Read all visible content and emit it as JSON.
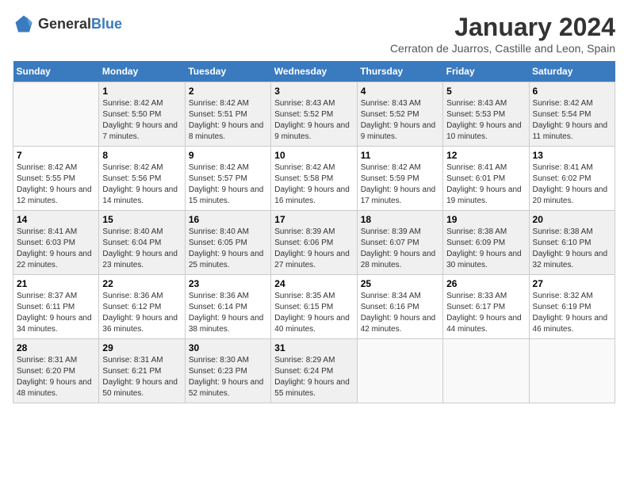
{
  "logo": {
    "text_general": "General",
    "text_blue": "Blue"
  },
  "title": "January 2024",
  "subtitle": "Cerraton de Juarros, Castille and Leon, Spain",
  "weekdays": [
    "Sunday",
    "Monday",
    "Tuesday",
    "Wednesday",
    "Thursday",
    "Friday",
    "Saturday"
  ],
  "weeks": [
    [
      {
        "day": "",
        "sunrise": "",
        "sunset": "",
        "daylight": "",
        "empty": true
      },
      {
        "day": "1",
        "sunrise": "Sunrise: 8:42 AM",
        "sunset": "Sunset: 5:50 PM",
        "daylight": "Daylight: 9 hours and 7 minutes.",
        "empty": false
      },
      {
        "day": "2",
        "sunrise": "Sunrise: 8:42 AM",
        "sunset": "Sunset: 5:51 PM",
        "daylight": "Daylight: 9 hours and 8 minutes.",
        "empty": false
      },
      {
        "day": "3",
        "sunrise": "Sunrise: 8:43 AM",
        "sunset": "Sunset: 5:52 PM",
        "daylight": "Daylight: 9 hours and 9 minutes.",
        "empty": false
      },
      {
        "day": "4",
        "sunrise": "Sunrise: 8:43 AM",
        "sunset": "Sunset: 5:52 PM",
        "daylight": "Daylight: 9 hours and 9 minutes.",
        "empty": false
      },
      {
        "day": "5",
        "sunrise": "Sunrise: 8:43 AM",
        "sunset": "Sunset: 5:53 PM",
        "daylight": "Daylight: 9 hours and 10 minutes.",
        "empty": false
      },
      {
        "day": "6",
        "sunrise": "Sunrise: 8:42 AM",
        "sunset": "Sunset: 5:54 PM",
        "daylight": "Daylight: 9 hours and 11 minutes.",
        "empty": false
      }
    ],
    [
      {
        "day": "7",
        "sunrise": "Sunrise: 8:42 AM",
        "sunset": "Sunset: 5:55 PM",
        "daylight": "Daylight: 9 hours and 12 minutes.",
        "empty": false
      },
      {
        "day": "8",
        "sunrise": "Sunrise: 8:42 AM",
        "sunset": "Sunset: 5:56 PM",
        "daylight": "Daylight: 9 hours and 14 minutes.",
        "empty": false
      },
      {
        "day": "9",
        "sunrise": "Sunrise: 8:42 AM",
        "sunset": "Sunset: 5:57 PM",
        "daylight": "Daylight: 9 hours and 15 minutes.",
        "empty": false
      },
      {
        "day": "10",
        "sunrise": "Sunrise: 8:42 AM",
        "sunset": "Sunset: 5:58 PM",
        "daylight": "Daylight: 9 hours and 16 minutes.",
        "empty": false
      },
      {
        "day": "11",
        "sunrise": "Sunrise: 8:42 AM",
        "sunset": "Sunset: 5:59 PM",
        "daylight": "Daylight: 9 hours and 17 minutes.",
        "empty": false
      },
      {
        "day": "12",
        "sunrise": "Sunrise: 8:41 AM",
        "sunset": "Sunset: 6:01 PM",
        "daylight": "Daylight: 9 hours and 19 minutes.",
        "empty": false
      },
      {
        "day": "13",
        "sunrise": "Sunrise: 8:41 AM",
        "sunset": "Sunset: 6:02 PM",
        "daylight": "Daylight: 9 hours and 20 minutes.",
        "empty": false
      }
    ],
    [
      {
        "day": "14",
        "sunrise": "Sunrise: 8:41 AM",
        "sunset": "Sunset: 6:03 PM",
        "daylight": "Daylight: 9 hours and 22 minutes.",
        "empty": false
      },
      {
        "day": "15",
        "sunrise": "Sunrise: 8:40 AM",
        "sunset": "Sunset: 6:04 PM",
        "daylight": "Daylight: 9 hours and 23 minutes.",
        "empty": false
      },
      {
        "day": "16",
        "sunrise": "Sunrise: 8:40 AM",
        "sunset": "Sunset: 6:05 PM",
        "daylight": "Daylight: 9 hours and 25 minutes.",
        "empty": false
      },
      {
        "day": "17",
        "sunrise": "Sunrise: 8:39 AM",
        "sunset": "Sunset: 6:06 PM",
        "daylight": "Daylight: 9 hours and 27 minutes.",
        "empty": false
      },
      {
        "day": "18",
        "sunrise": "Sunrise: 8:39 AM",
        "sunset": "Sunset: 6:07 PM",
        "daylight": "Daylight: 9 hours and 28 minutes.",
        "empty": false
      },
      {
        "day": "19",
        "sunrise": "Sunrise: 8:38 AM",
        "sunset": "Sunset: 6:09 PM",
        "daylight": "Daylight: 9 hours and 30 minutes.",
        "empty": false
      },
      {
        "day": "20",
        "sunrise": "Sunrise: 8:38 AM",
        "sunset": "Sunset: 6:10 PM",
        "daylight": "Daylight: 9 hours and 32 minutes.",
        "empty": false
      }
    ],
    [
      {
        "day": "21",
        "sunrise": "Sunrise: 8:37 AM",
        "sunset": "Sunset: 6:11 PM",
        "daylight": "Daylight: 9 hours and 34 minutes.",
        "empty": false
      },
      {
        "day": "22",
        "sunrise": "Sunrise: 8:36 AM",
        "sunset": "Sunset: 6:12 PM",
        "daylight": "Daylight: 9 hours and 36 minutes.",
        "empty": false
      },
      {
        "day": "23",
        "sunrise": "Sunrise: 8:36 AM",
        "sunset": "Sunset: 6:14 PM",
        "daylight": "Daylight: 9 hours and 38 minutes.",
        "empty": false
      },
      {
        "day": "24",
        "sunrise": "Sunrise: 8:35 AM",
        "sunset": "Sunset: 6:15 PM",
        "daylight": "Daylight: 9 hours and 40 minutes.",
        "empty": false
      },
      {
        "day": "25",
        "sunrise": "Sunrise: 8:34 AM",
        "sunset": "Sunset: 6:16 PM",
        "daylight": "Daylight: 9 hours and 42 minutes.",
        "empty": false
      },
      {
        "day": "26",
        "sunrise": "Sunrise: 8:33 AM",
        "sunset": "Sunset: 6:17 PM",
        "daylight": "Daylight: 9 hours and 44 minutes.",
        "empty": false
      },
      {
        "day": "27",
        "sunrise": "Sunrise: 8:32 AM",
        "sunset": "Sunset: 6:19 PM",
        "daylight": "Daylight: 9 hours and 46 minutes.",
        "empty": false
      }
    ],
    [
      {
        "day": "28",
        "sunrise": "Sunrise: 8:31 AM",
        "sunset": "Sunset: 6:20 PM",
        "daylight": "Daylight: 9 hours and 48 minutes.",
        "empty": false
      },
      {
        "day": "29",
        "sunrise": "Sunrise: 8:31 AM",
        "sunset": "Sunset: 6:21 PM",
        "daylight": "Daylight: 9 hours and 50 minutes.",
        "empty": false
      },
      {
        "day": "30",
        "sunrise": "Sunrise: 8:30 AM",
        "sunset": "Sunset: 6:23 PM",
        "daylight": "Daylight: 9 hours and 52 minutes.",
        "empty": false
      },
      {
        "day": "31",
        "sunrise": "Sunrise: 8:29 AM",
        "sunset": "Sunset: 6:24 PM",
        "daylight": "Daylight: 9 hours and 55 minutes.",
        "empty": false
      },
      {
        "day": "",
        "sunrise": "",
        "sunset": "",
        "daylight": "",
        "empty": true
      },
      {
        "day": "",
        "sunrise": "",
        "sunset": "",
        "daylight": "",
        "empty": true
      },
      {
        "day": "",
        "sunrise": "",
        "sunset": "",
        "daylight": "",
        "empty": true
      }
    ]
  ]
}
